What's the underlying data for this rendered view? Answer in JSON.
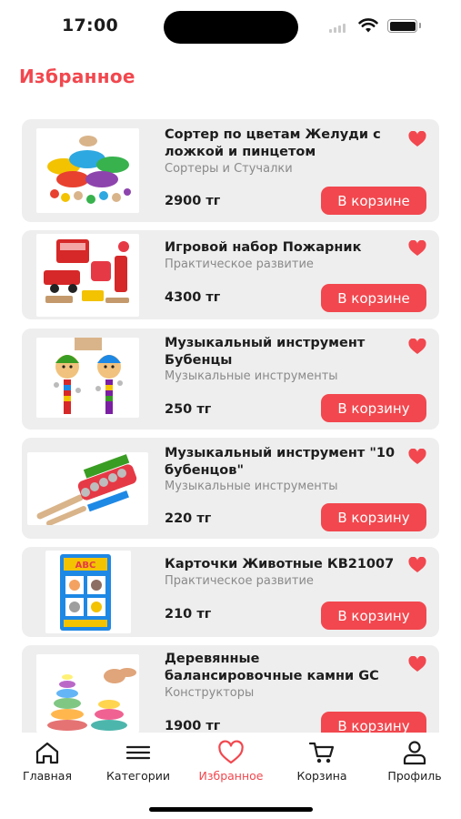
{
  "status_bar": {
    "time": "17:00"
  },
  "header": {
    "title": "Избранное"
  },
  "colors": {
    "accent": "#f2474e",
    "card_bg": "#eeeeee",
    "muted_text": "#8a8a8a"
  },
  "favorites": [
    {
      "title": "Сортер по цветам Желуди с ложкой и пинцетом",
      "category": "Сортеры и Стучалки",
      "price": "2900 тг",
      "button": "В корзине",
      "in_cart": true,
      "favorite": true
    },
    {
      "title": "Игровой набор Пожарник",
      "category": "Практическое развитие",
      "price": "4300 тг",
      "button": "В корзине",
      "in_cart": true,
      "favorite": true
    },
    {
      "title": "Музыкальный инструмент Бубенцы",
      "category": "Музыкальные инструменты",
      "price": "250 тг",
      "button": "В корзину",
      "in_cart": false,
      "favorite": true
    },
    {
      "title": "Музыкальный инструмент \"10 бубенцов\"",
      "category": "Музыкальные инструменты",
      "price": "220 тг",
      "button": "В корзину",
      "in_cart": false,
      "favorite": true
    },
    {
      "title": "Карточки Животные КВ21007",
      "category": "Практическое развитие",
      "price": "210 тг",
      "button": "В корзину",
      "in_cart": false,
      "favorite": true
    },
    {
      "title": "Деревянные балансировочные камни GC",
      "category": "Конструкторы",
      "price": "1900 тг",
      "button": "В корзину",
      "in_cart": false,
      "favorite": true
    }
  ],
  "tabbar": {
    "items": [
      {
        "label": "Главная",
        "icon": "home-icon",
        "active": false
      },
      {
        "label": "Категории",
        "icon": "menu-icon",
        "active": false
      },
      {
        "label": "Избранное",
        "icon": "heart-icon",
        "active": true
      },
      {
        "label": "Корзина",
        "icon": "cart-icon",
        "active": false
      },
      {
        "label": "Профиль",
        "icon": "user-icon",
        "active": false
      }
    ]
  }
}
